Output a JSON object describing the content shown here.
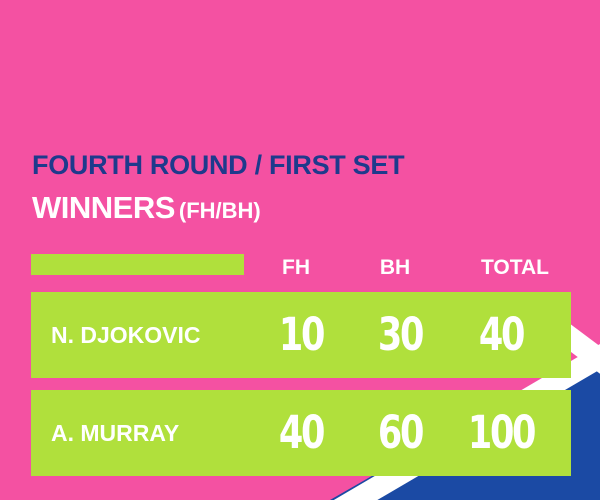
{
  "colors": {
    "background": "#f451a2",
    "accent": "#b0e03c",
    "subtitle": "#1e3a8c",
    "text": "#ffffff",
    "flag_blue": "#1b4aa4",
    "flag_white": "#ffffff"
  },
  "header": {
    "subtitle": "FOURTH ROUND / FIRST SET",
    "title_main": "WINNERS",
    "title_paren": "(FH/BH)"
  },
  "columns": [
    "FH",
    "BH",
    "TOTAL"
  ],
  "rows": [
    {
      "name": "N. DJOKOVIC",
      "fh": "10",
      "bh": "30",
      "total": "40"
    },
    {
      "name": "A. MURRAY",
      "fh": "40",
      "bh": "60",
      "total": "100"
    }
  ]
}
